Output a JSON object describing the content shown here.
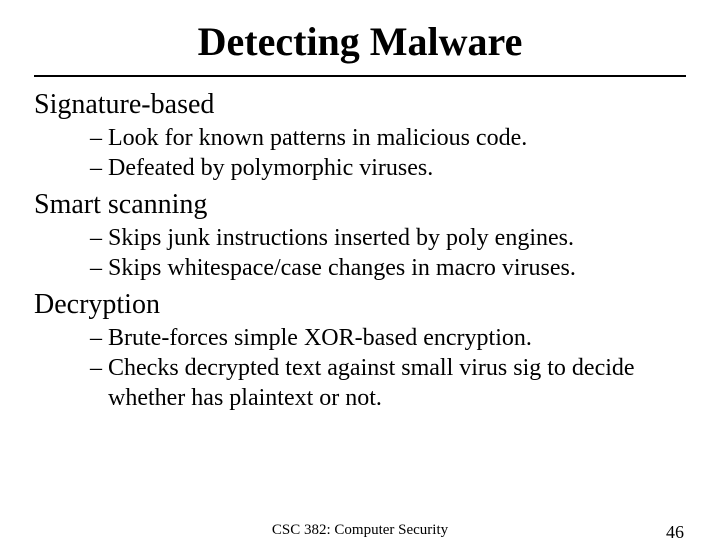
{
  "title": "Detecting Malware",
  "sections": [
    {
      "heading": "Signature-based",
      "bullets": [
        "Look for known patterns in malicious code.",
        "Defeated by polymorphic viruses."
      ]
    },
    {
      "heading": "Smart scanning",
      "bullets": [
        "Skips junk instructions inserted by poly engines.",
        "Skips whitespace/case changes in macro viruses."
      ]
    },
    {
      "heading": "Decryption",
      "bullets": [
        "Brute-forces simple XOR-based encryption.",
        "Checks decrypted text against small virus sig to decide whether has plaintext or not."
      ]
    }
  ],
  "footer": {
    "course": "CSC 382: Computer Security",
    "page": "46"
  },
  "dash": "– "
}
